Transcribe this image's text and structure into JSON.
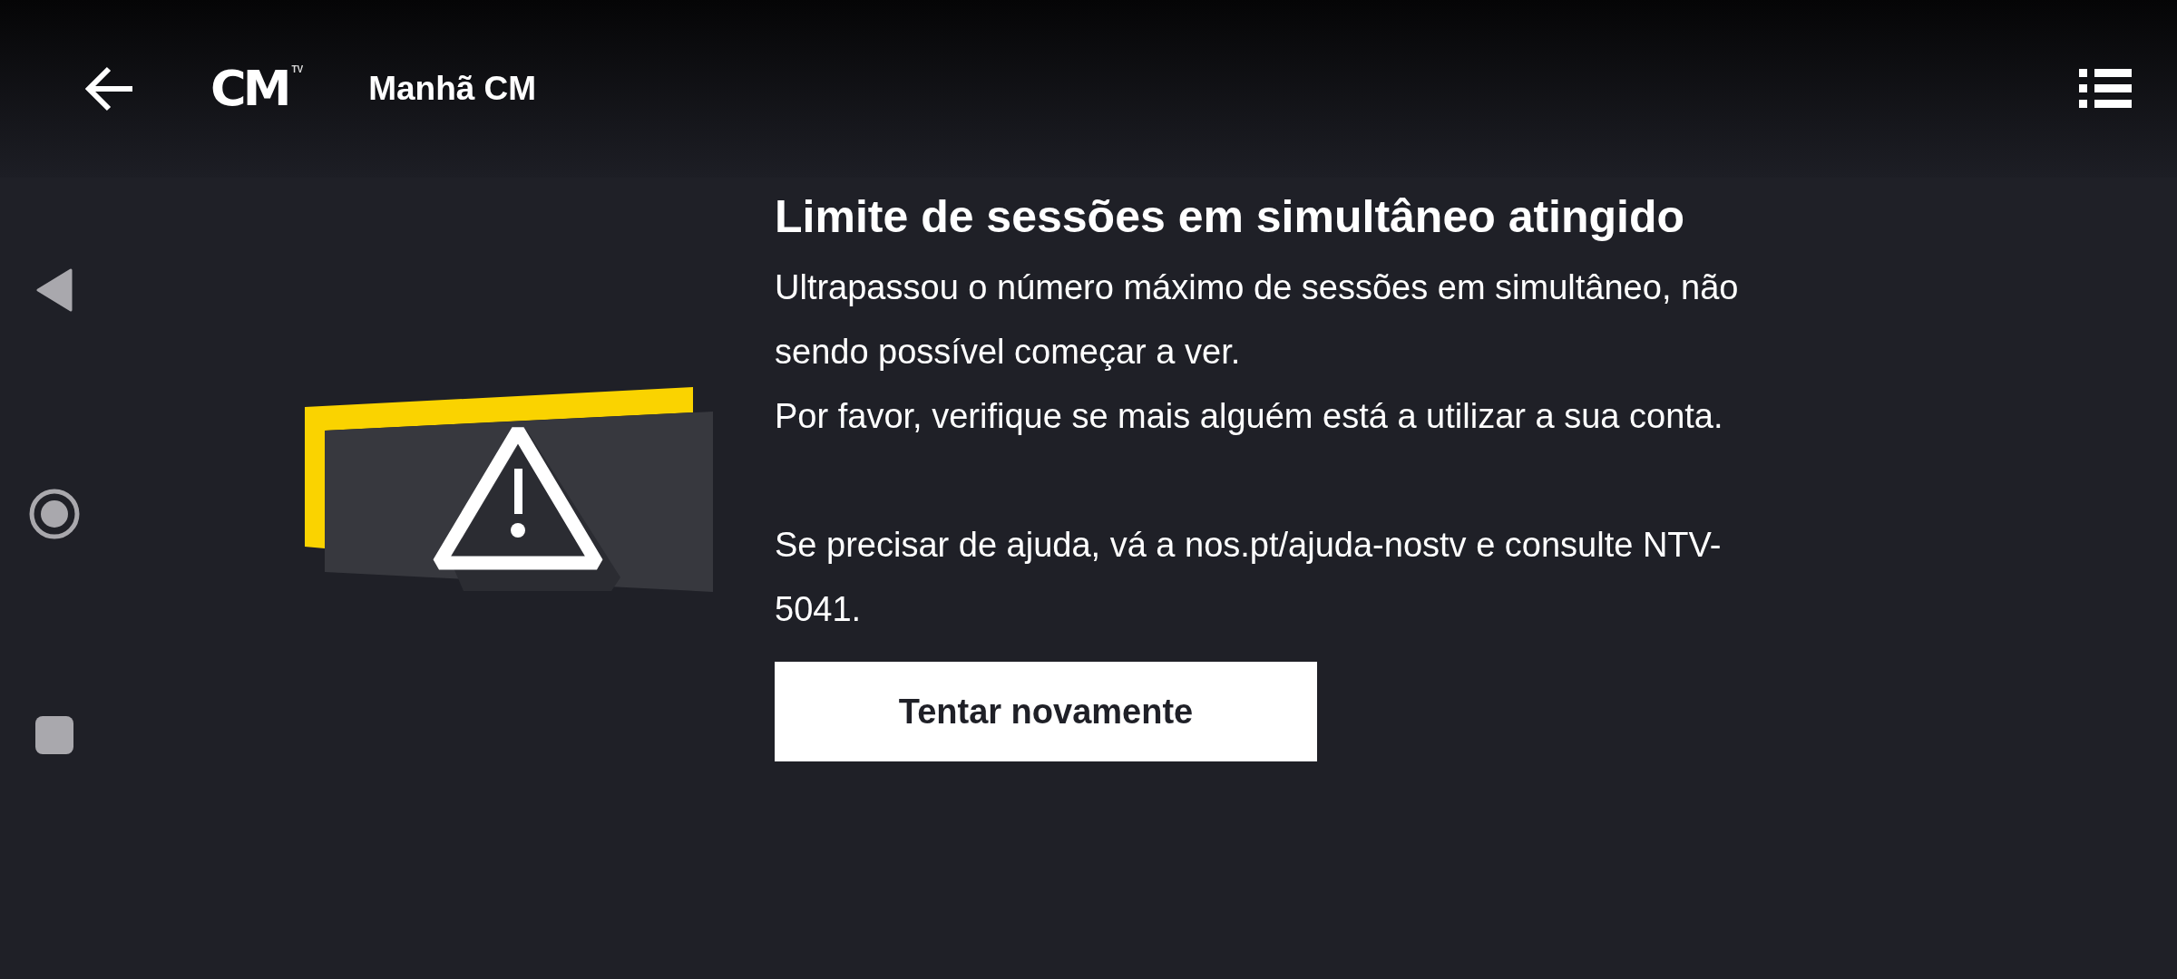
{
  "header": {
    "logo": {
      "text": "CM",
      "badge": "TV"
    },
    "title": "Manhã CM"
  },
  "error": {
    "title": "Limite de sessões em simultâneo atingido",
    "paragraphs": [
      "Ultrapassou o número máximo de sessões em simultâneo, não sendo possível começar a ver.",
      "Por favor, verifique se mais alguém está a utilizar a sua conta.",
      "Se precisar de ajuda, vá a nos.pt/ajuda-nostv e consulte NTV-5041."
    ],
    "button": "Tentar novamente"
  }
}
